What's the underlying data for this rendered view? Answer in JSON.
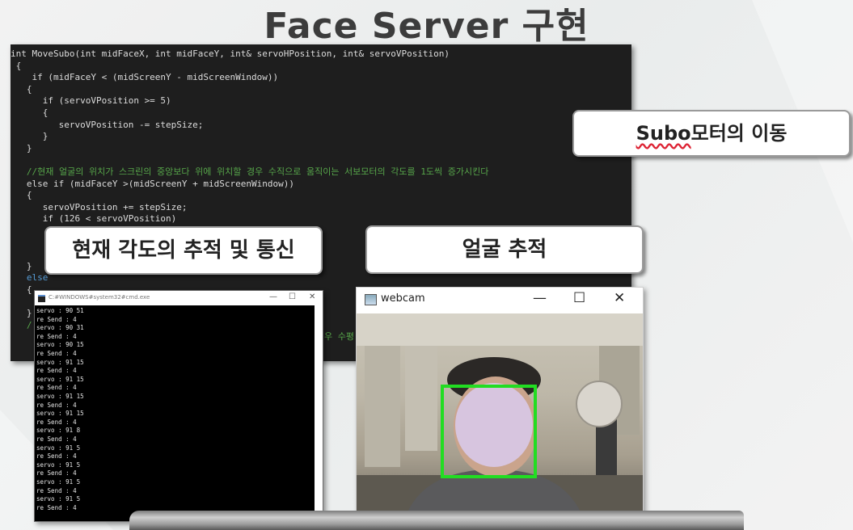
{
  "slide": {
    "title": "Face Server 구현"
  },
  "code": {
    "lines": [
      {
        "text": "int MoveSubo(int midFaceX, int midFaceY, int& servoHPosition, int& servoVPosition)",
        "color": "#dcdcdc"
      },
      {
        "text": " {",
        "color": "#dcdcdc"
      },
      {
        "text": "    if (midFaceY < (midScreenY - midScreenWindow))",
        "color": "#dcdcdc"
      },
      {
        "text": "   {",
        "color": "#dcdcdc"
      },
      {
        "text": "      if (servoVPosition >= 5)",
        "color": "#dcdcdc"
      },
      {
        "text": "      {",
        "color": "#dcdcdc"
      },
      {
        "text": "         servoVPosition -= stepSize;",
        "color": "#dcdcdc"
      },
      {
        "text": "      }",
        "color": "#dcdcdc"
      },
      {
        "text": "   }",
        "color": "#dcdcdc"
      },
      {
        "text": "",
        "color": "#dcdcdc"
      },
      {
        "text": "   //현재 얼굴의 위치가 스크린의 중앙보다 위에 위치할 경우 수직으로 움직이는 서보모터의 각도를 1도씩 증가시킨다",
        "color": "#57a64a"
      },
      {
        "text": "   else if (midFaceY >(midScreenY + midScreenWindow))",
        "color": "#dcdcdc"
      },
      {
        "text": "   {",
        "color": "#dcdcdc"
      },
      {
        "text": "      servoVPosition += stepSize;",
        "color": "#dcdcdc"
      },
      {
        "text": "      if (126 < servoVPosition)",
        "color": "#dcdcdc"
      },
      {
        "text": "",
        "color": "#dcdcdc"
      },
      {
        "text": "",
        "color": "#dcdcdc"
      },
      {
        "text": "",
        "color": "#dcdcdc"
      },
      {
        "text": "   }",
        "color": "#dcdcdc"
      },
      {
        "text": "   else",
        "color": "#569cd6"
      },
      {
        "text": "   {",
        "color": "#dcdcdc"
      },
      {
        "text": "",
        "color": "#dcdcdc"
      },
      {
        "text": "   }",
        "color": "#dcdcdc"
      },
      {
        "text": "   /",
        "color": "#57a64a"
      },
      {
        "text": "",
        "color": "#dcdcdc"
      }
    ],
    "partial_comment": "우 수평",
    "colors": {
      "keyword": "#569cd6",
      "comment": "#57a64a",
      "text": "#dcdcdc",
      "background": "#1e1e1e"
    }
  },
  "callouts": {
    "motor_prefix": "Subo",
    "motor_suffix": "모터의 이동",
    "angle": "현재 각도의 추적 및 통신",
    "face": "얼굴 추적"
  },
  "cmd": {
    "title": "C:#WINDOWS#system32#cmd.exe",
    "minimize": "—",
    "maximize": "☐",
    "close": "✕",
    "scroll_arrow": "▾",
    "lines": [
      "servo : 90 51",
      "re Send : 4",
      "servo : 90 31",
      "re Send : 4",
      "servo : 90 15",
      "re Send : 4",
      "servo : 91 15",
      "re Send : 4",
      "servo : 91 15",
      "re Send : 4",
      "servo : 91 15",
      "re Send : 4",
      "servo : 91 15",
      "re Send : 4",
      "servo : 91 8",
      "re Send : 4",
      "servo : 91 5",
      "re Send : 4",
      "servo : 91 5",
      "re Send : 4",
      "servo : 91 5",
      "re Send : 4",
      "servo : 91 5",
      "re Send : 4"
    ]
  },
  "webcam": {
    "title": "webcam",
    "minimize": "—",
    "maximize": "☐",
    "close": "✕",
    "face_box_color": "#22dd22",
    "blur_color": "#d8c8e6"
  }
}
